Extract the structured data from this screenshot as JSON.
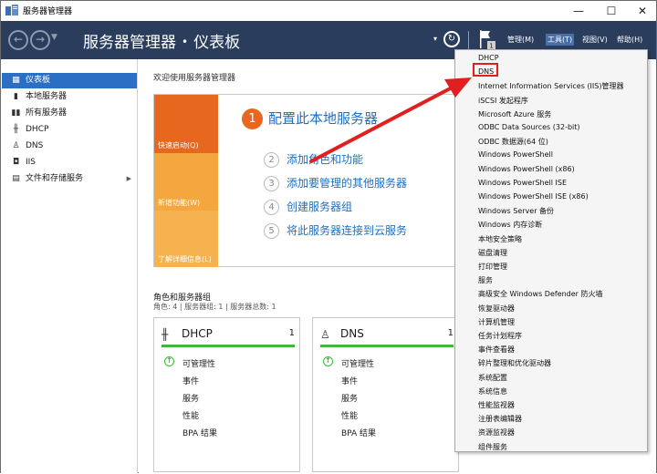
{
  "window": {
    "title": "服务器管理器"
  },
  "toolbar": {
    "app_name": "服务器管理器",
    "separator": "•",
    "current_page": "仪表板",
    "menus": [
      "管理(M)",
      "工具(T)",
      "视图(V)",
      "帮助(H)"
    ],
    "flag_badge": "1"
  },
  "sidebar": {
    "items": [
      {
        "label": "仪表板",
        "icon": "dashboard-icon"
      },
      {
        "label": "本地服务器",
        "icon": "server-icon"
      },
      {
        "label": "所有服务器",
        "icon": "servers-icon"
      },
      {
        "label": "DHCP",
        "icon": "dhcp-icon"
      },
      {
        "label": "DNS",
        "icon": "dns-icon"
      },
      {
        "label": "IIS",
        "icon": "iis-icon"
      },
      {
        "label": "文件和存储服务",
        "icon": "storage-icon"
      }
    ]
  },
  "main": {
    "welcome": "欢迎使用服务器管理器",
    "tiles": [
      "快速启动(Q)",
      "新增功能(W)",
      "了解详细信息(L)"
    ],
    "steps": [
      {
        "num": "1",
        "label": "配置此本地服务器"
      },
      {
        "num": "2",
        "label": "添加角色和功能"
      },
      {
        "num": "3",
        "label": "添加要管理的其他服务器"
      },
      {
        "num": "4",
        "label": "创建服务器组"
      },
      {
        "num": "5",
        "label": "将此服务器连接到云服务"
      }
    ],
    "roles_title": "角色和服务器组",
    "roles_sub": "角色: 4 | 服务器组: 1 | 服务器总数: 1",
    "cards": [
      {
        "name": "DHCP",
        "count": "1",
        "rows": [
          "可管理性",
          "事件",
          "服务",
          "性能",
          "BPA 结果"
        ]
      },
      {
        "name": "DNS",
        "count": "1",
        "rows": [
          "可管理性",
          "事件",
          "服务",
          "性能",
          "BPA 结果"
        ]
      }
    ]
  },
  "tools_menu": {
    "items": [
      "DHCP",
      "DNS",
      "Internet Information Services (IIS)管理器",
      "iSCSI 发起程序",
      "Microsoft Azure 服务",
      "ODBC Data Sources (32-bit)",
      "ODBC 数据源(64 位)",
      "Windows PowerShell",
      "Windows PowerShell (x86)",
      "Windows PowerShell ISE",
      "Windows PowerShell ISE (x86)",
      "Windows Server 备份",
      "Windows 内存诊断",
      "本地安全策略",
      "磁盘清理",
      "打印管理",
      "服务",
      "高级安全 Windows Defender 防火墙",
      "恢复驱动器",
      "计算机管理",
      "任务计划程序",
      "事件查看器",
      "碎片整理和优化驱动器",
      "系统配置",
      "系统信息",
      "性能监视器",
      "注册表编辑器",
      "资源监视器",
      "组件服务"
    ],
    "highlighted_index": 1,
    "highlight_color": "#e02020"
  },
  "colors": {
    "toolbar_bg": "#2b3d5c",
    "accent_orange": "#e8671e",
    "link_blue": "#1f6fbf",
    "status_green": "#3cb83c",
    "sidebar_active": "#2b6fc4"
  }
}
